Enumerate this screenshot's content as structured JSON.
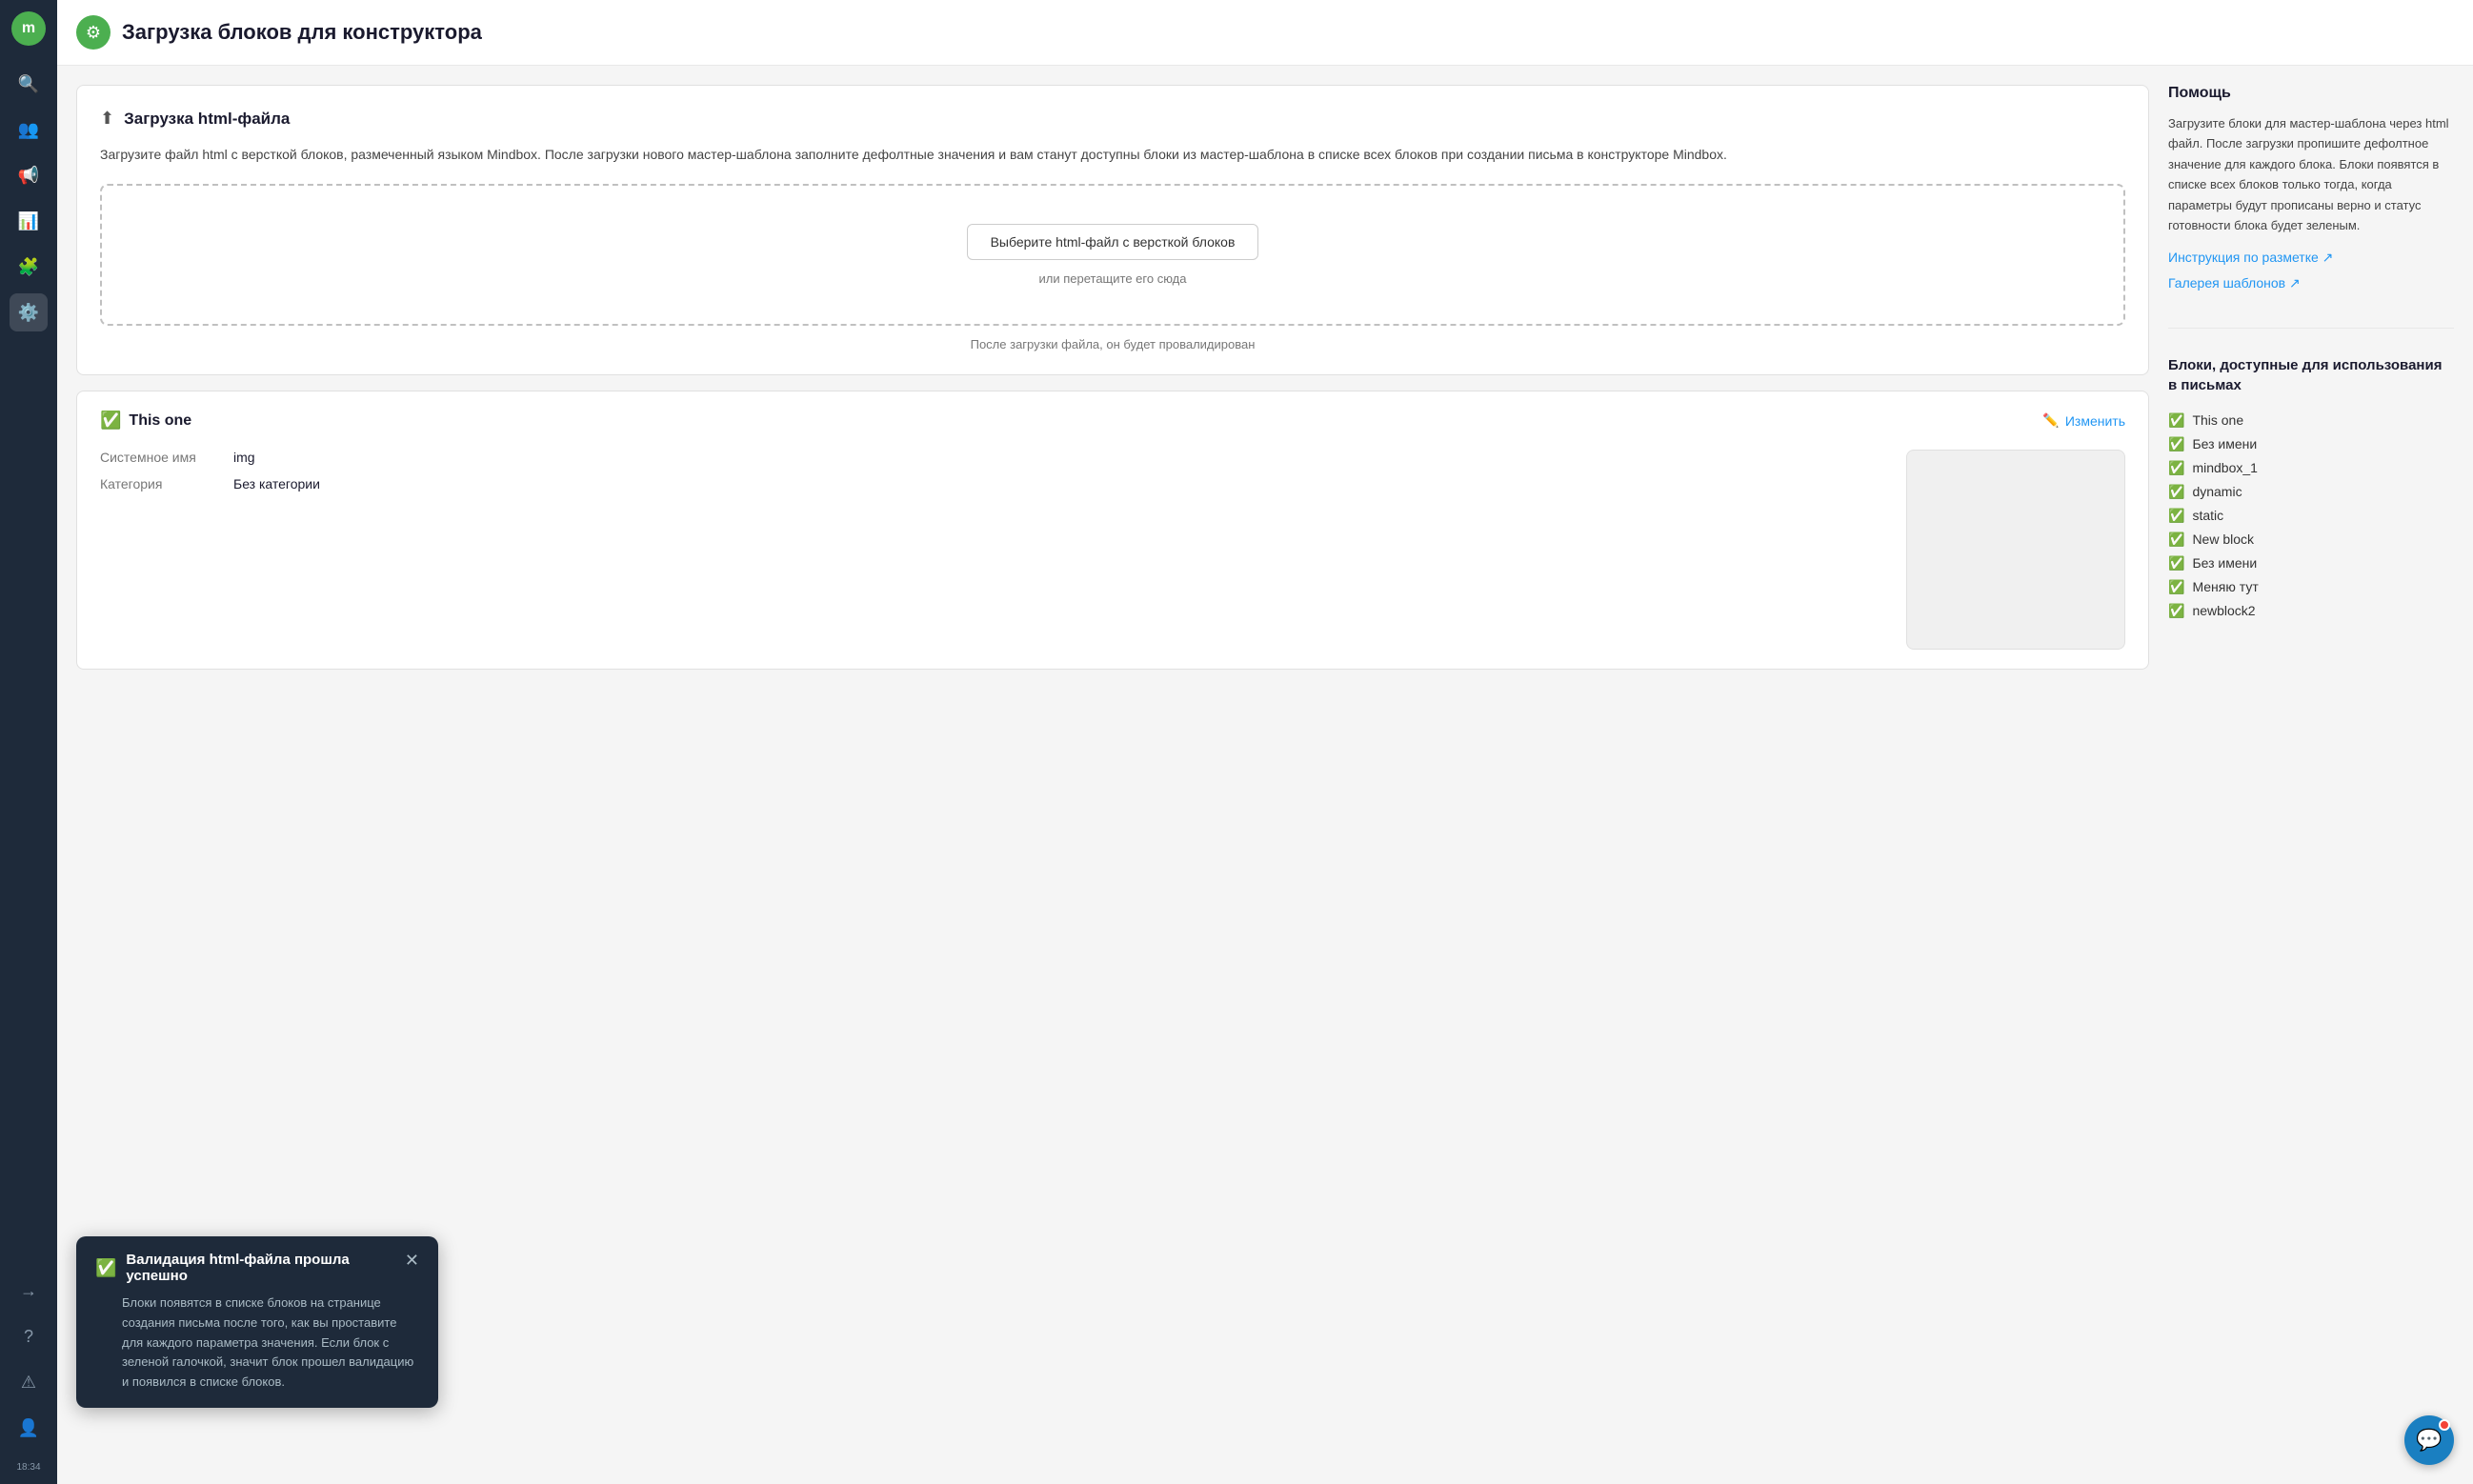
{
  "sidebar": {
    "logo_letter": "m",
    "time": "18:34",
    "items": [
      {
        "name": "search",
        "icon": "🔍",
        "active": false
      },
      {
        "name": "users",
        "icon": "👥",
        "active": false
      },
      {
        "name": "campaigns",
        "icon": "📢",
        "active": false
      },
      {
        "name": "analytics",
        "icon": "📊",
        "active": false
      },
      {
        "name": "integrations",
        "icon": "🔧",
        "active": false
      },
      {
        "name": "settings",
        "icon": "⚙️",
        "active": true
      }
    ],
    "bottom_items": [
      {
        "name": "arrow-right",
        "icon": "→"
      },
      {
        "name": "help",
        "icon": "?"
      },
      {
        "name": "warning",
        "icon": "⚠"
      },
      {
        "name": "user",
        "icon": "👤"
      }
    ]
  },
  "page": {
    "title": "Загрузка блоков для конструктора",
    "header_icon": "⚙"
  },
  "upload_card": {
    "title": "Загрузка html-файла",
    "description": "Загрузите файл html с версткой блоков, размеченный языком Mindbox. После загрузки нового мастер-шаблона заполните дефолтные значения и вам станут доступны блоки из мастер-шаблона в списке всех блоков при создании письма в конструкторе Mindbox.",
    "upload_button_label": "Выберите html-файл с версткой блоков",
    "drop_hint": "или перетащите его сюда",
    "validation_note": "После загрузки файла, он будет провалидирован"
  },
  "block_card": {
    "name": "This one",
    "edit_label": "Изменить",
    "system_name_label": "Системное имя",
    "system_name_value": "img",
    "category_label": "Категория",
    "category_value": "Без категории"
  },
  "toast": {
    "title": "Валидация html-файла прошла успешно",
    "body": "Блоки появятся в списке блоков на странице создания письма после того, как вы проставите для каждого параметра значения. Если блок с зеленой галочкой, значит блок прошел валидацию и появился в списке блоков."
  },
  "help_panel": {
    "title": "Помощь",
    "text": "Загрузите блоки для мастер-шаблона через html файл. После загрузки пропишите дефолтное значение для каждого блока. Блоки появятся в списке всех блоков только тогда, когда параметры будут прописаны верно и статус готовности блока будет зеленым.",
    "link1": "Инструкция по разметке ↗",
    "link2": "Галерея шаблонов ↗"
  },
  "blocks_section": {
    "title": "Блоки, доступные для использования в письмах",
    "items": [
      "This one",
      "Без имени",
      "mindbox_1",
      "dynamic",
      "static",
      "New block",
      "Без имени",
      "Меняю тут",
      "newblock2"
    ]
  }
}
